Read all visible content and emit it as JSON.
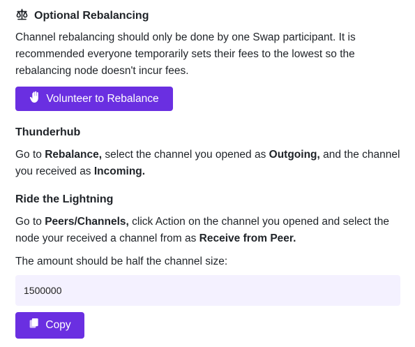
{
  "header": {
    "icon": "scale-balance-icon",
    "title": "Optional Rebalancing"
  },
  "intro": {
    "text": "Channel rebalancing should only be done by one Swap participant. It is recommended everyone temporarily sets their fees to the lowest so the rebalancing node doesn't incur fees."
  },
  "volunteer_button": {
    "icon": "raised-hand-icon",
    "label": "Volunteer to Rebalance"
  },
  "thunderhub": {
    "heading": "Thunderhub",
    "p1": "Go to ",
    "b1": "Rebalance,",
    "p2": " select the channel you opened as ",
    "b2": "Outgoing,",
    "p3": " and the channel you received as ",
    "b3": "Incoming."
  },
  "rtl": {
    "heading": "Ride the Lightning",
    "p1": "Go to ",
    "b1": "Peers/Channels,",
    "p2": " click Action on the channel you opened and select the node your received a channel from as ",
    "b2": "Receive from Peer."
  },
  "amount": {
    "label": "The amount should be half the channel size:",
    "value": "1500000"
  },
  "copy_button": {
    "icon": "copy-icon",
    "label": "Copy"
  },
  "colors": {
    "accent": "#6a2fe1",
    "field_bg": "#f4f1ff"
  }
}
